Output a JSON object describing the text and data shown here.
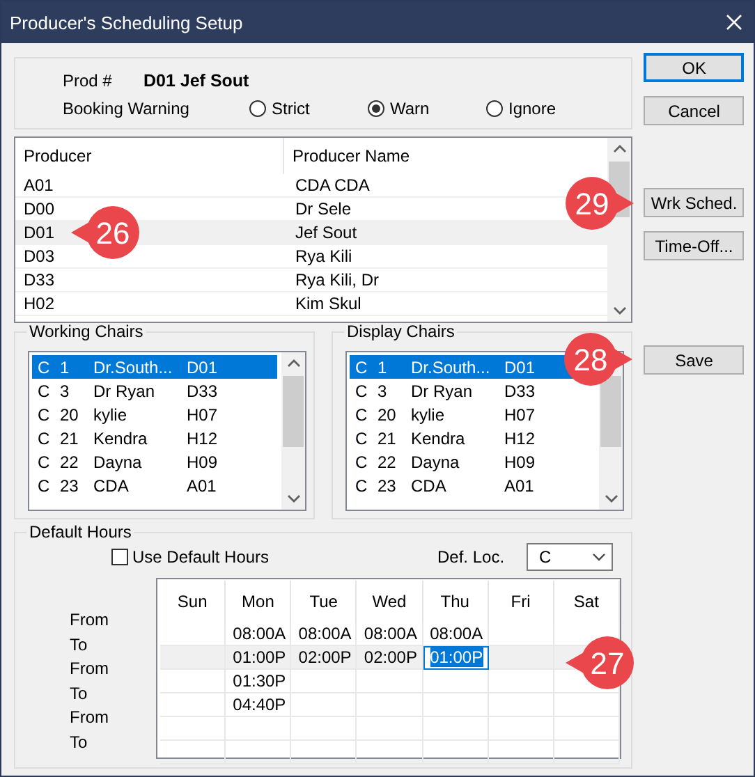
{
  "window": {
    "title": "Producer's Scheduling Setup"
  },
  "prod": {
    "label": "Prod #",
    "value": "D01 Jef Sout"
  },
  "booking_warning": {
    "label": "Booking Warning",
    "options": [
      {
        "label": "Strict",
        "selected": false
      },
      {
        "label": "Warn",
        "selected": true
      },
      {
        "label": "Ignore",
        "selected": false
      }
    ]
  },
  "producers": {
    "columns": [
      "Producer",
      "Producer Name"
    ],
    "rows": [
      {
        "code": "A01",
        "name": "CDA CDA",
        "selected": false
      },
      {
        "code": "D00",
        "name": "Dr Sele",
        "selected": false
      },
      {
        "code": "D01",
        "name": "Jef Sout",
        "selected": true
      },
      {
        "code": "D03",
        "name": "Rya Kili",
        "selected": false
      },
      {
        "code": "D33",
        "name": "Rya Kili, Dr",
        "selected": false
      },
      {
        "code": "H02",
        "name": "Kim Skul",
        "selected": false
      }
    ]
  },
  "chair_lists": [
    {
      "title": "Working Chairs",
      "items": [
        {
          "loc": "C",
          "num": "1",
          "name": "Dr.South...",
          "code": "D01",
          "selected": true
        },
        {
          "loc": "C",
          "num": "3",
          "name": "Dr Ryan",
          "code": "D33",
          "selected": false
        },
        {
          "loc": "C",
          "num": "20",
          "name": "kylie",
          "code": "H07",
          "selected": false
        },
        {
          "loc": "C",
          "num": "21",
          "name": "Kendra",
          "code": "H12",
          "selected": false
        },
        {
          "loc": "C",
          "num": "22",
          "name": "Dayna",
          "code": "H09",
          "selected": false
        },
        {
          "loc": "C",
          "num": "23",
          "name": "CDA",
          "code": "A01",
          "selected": false
        }
      ]
    },
    {
      "title": "Display Chairs",
      "items": [
        {
          "loc": "C",
          "num": "1",
          "name": "Dr.South...",
          "code": "D01",
          "selected": true
        },
        {
          "loc": "C",
          "num": "3",
          "name": "Dr Ryan",
          "code": "D33",
          "selected": false
        },
        {
          "loc": "C",
          "num": "20",
          "name": "kylie",
          "code": "H07",
          "selected": false
        },
        {
          "loc": "C",
          "num": "21",
          "name": "Kendra",
          "code": "H12",
          "selected": false
        },
        {
          "loc": "C",
          "num": "22",
          "name": "Dayna",
          "code": "H09",
          "selected": false
        },
        {
          "loc": "C",
          "num": "23",
          "name": "CDA",
          "code": "A01",
          "selected": false
        }
      ]
    }
  ],
  "default_hours": {
    "title": "Default Hours",
    "use_default": {
      "label": "Use Default Hours",
      "checked": false
    },
    "def_loc": {
      "label": "Def. Loc.",
      "value": "C"
    },
    "days": [
      "Sun",
      "Mon",
      "Tue",
      "Wed",
      "Thu",
      "Fri",
      "Sat"
    ],
    "rows": [
      {
        "label": "From",
        "selected": false,
        "cells": [
          null,
          {
            "text": "08:00A",
            "selected": false
          },
          {
            "text": "08:00A",
            "selected": false
          },
          {
            "text": "08:00A",
            "selected": false
          },
          {
            "text": "08:00A",
            "selected": false
          },
          null,
          null
        ]
      },
      {
        "label": "To",
        "selected": true,
        "cells": [
          null,
          {
            "text": "01:00P",
            "selected": false
          },
          {
            "text": "02:00P",
            "selected": false
          },
          {
            "text": "02:00P",
            "selected": false
          },
          {
            "text": "01:00P",
            "selected": true
          },
          null,
          null
        ]
      },
      {
        "label": "From",
        "selected": false,
        "cells": [
          null,
          {
            "text": "01:30P",
            "selected": false
          },
          null,
          null,
          null,
          null,
          null
        ]
      },
      {
        "label": "To",
        "selected": false,
        "cells": [
          null,
          {
            "text": "04:40P",
            "selected": false
          },
          null,
          null,
          null,
          null,
          null
        ]
      },
      {
        "label": "From",
        "selected": false,
        "cells": [
          null,
          null,
          null,
          null,
          null,
          null,
          null
        ]
      },
      {
        "label": "To",
        "selected": false,
        "cells": [
          null,
          null,
          null,
          null,
          null,
          null,
          null
        ]
      }
    ]
  },
  "buttons": [
    {
      "label": "OK",
      "kind": "default"
    },
    {
      "label": "Cancel",
      "kind": "normal"
    },
    {
      "label": "Wrk Sched.",
      "kind": "normal"
    },
    {
      "label": "Time-Off...",
      "kind": "normal"
    },
    {
      "label": "Save",
      "kind": "normal"
    }
  ],
  "callouts": [
    {
      "label": "26"
    },
    {
      "label": "29"
    },
    {
      "label": "28"
    },
    {
      "label": "27"
    }
  ]
}
